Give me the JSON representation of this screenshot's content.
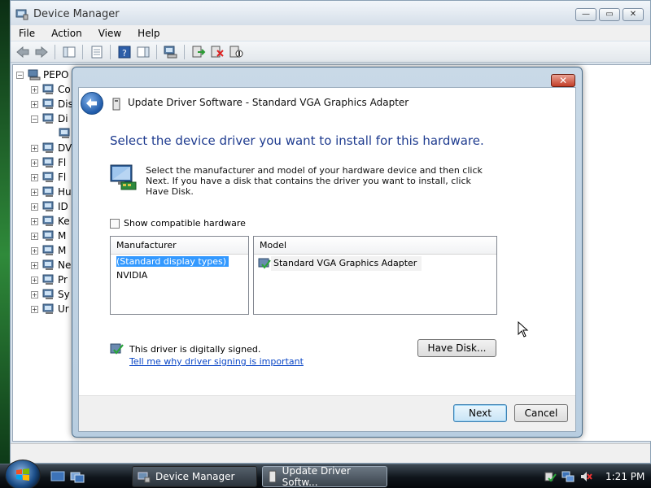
{
  "device_manager": {
    "title": "Device Manager",
    "menu": [
      "File",
      "Action",
      "View",
      "Help"
    ],
    "tree": {
      "root": "PEPO",
      "items": [
        {
          "label": "Co",
          "icon": "computer-icon",
          "expanded": false
        },
        {
          "label": "Dis",
          "icon": "disk-drive-icon",
          "expanded": false
        },
        {
          "label": "Di",
          "icon": "display-adapter-icon",
          "expanded": true
        },
        {
          "label": "",
          "icon": "display-device-icon",
          "expanded": null
        },
        {
          "label": "DV",
          "icon": "dvd-drive-icon",
          "expanded": false
        },
        {
          "label": "Fl",
          "icon": "floppy-controller-icon",
          "expanded": false
        },
        {
          "label": "Fl",
          "icon": "floppy-drive-icon",
          "expanded": false
        },
        {
          "label": "Hu",
          "icon": "hid-icon",
          "expanded": false
        },
        {
          "label": "ID",
          "icon": "ide-controller-icon",
          "expanded": false
        },
        {
          "label": "Ke",
          "icon": "keyboard-icon",
          "expanded": false
        },
        {
          "label": "M",
          "icon": "mouse-icon",
          "expanded": false
        },
        {
          "label": "M",
          "icon": "monitor-icon",
          "expanded": false
        },
        {
          "label": "Ne",
          "icon": "network-adapter-icon",
          "expanded": false
        },
        {
          "label": "Pr",
          "icon": "processor-icon",
          "expanded": false
        },
        {
          "label": "Sy",
          "icon": "system-devices-icon",
          "expanded": false
        },
        {
          "label": "Ur",
          "icon": "usb-controller-icon",
          "expanded": false
        }
      ]
    }
  },
  "dialog": {
    "title": "Update Driver Software - Standard VGA Graphics Adapter",
    "heading": "Select the device driver you want to install for this hardware.",
    "description": "Select the manufacturer and model of your hardware device and then click Next. If you have a disk that contains the driver you want to install, click Have Disk.",
    "show_compatible_label": "Show compatible hardware",
    "show_compatible_checked": false,
    "manufacturer_header": "Manufacturer",
    "manufacturers": [
      "(Standard display types)",
      "NVIDIA"
    ],
    "selected_manufacturer": "(Standard display types)",
    "model_header": "Model",
    "models": [
      "Standard VGA Graphics Adapter"
    ],
    "signed_text": "This driver is digitally signed.",
    "signed_link": "Tell me why driver signing is important",
    "have_disk_label": "Have Disk...",
    "next_label": "Next",
    "cancel_label": "Cancel"
  },
  "taskbar": {
    "buttons": [
      "Device Manager",
      "Update Driver Softw..."
    ],
    "clock": "1:21 PM"
  }
}
